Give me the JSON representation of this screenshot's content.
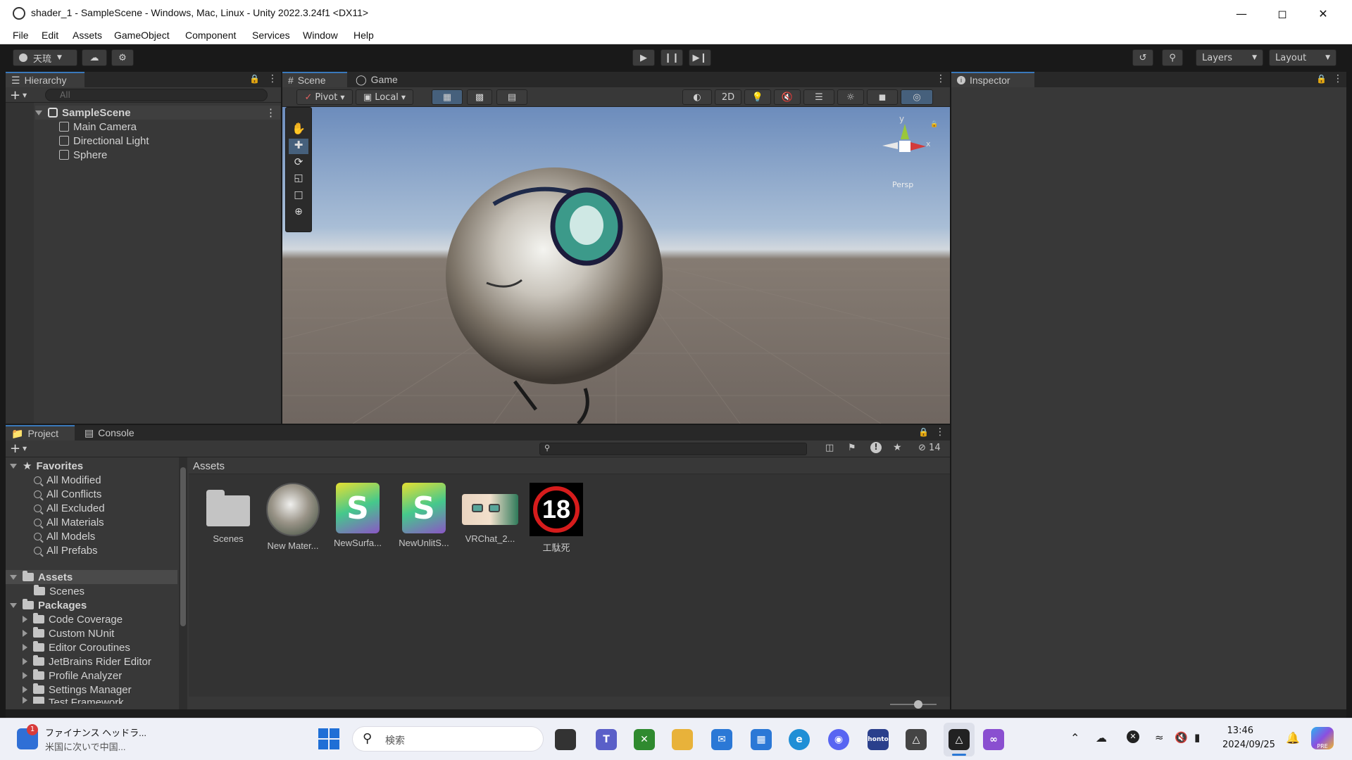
{
  "window": {
    "title": "shader_1 - SampleScene - Windows, Mac, Linux - Unity 2022.3.24f1 <DX11>"
  },
  "menu": [
    "File",
    "Edit",
    "Assets",
    "GameObject",
    "Component",
    "Services",
    "Window",
    "Help"
  ],
  "toolbar": {
    "account": "天琉",
    "layers": "Layers",
    "layout": "Layout"
  },
  "hierarchy": {
    "tab": "Hierarchy",
    "search_placeholder": "All",
    "scene": "SampleScene",
    "objects": [
      "Main Camera",
      "Directional Light",
      "Sphere"
    ]
  },
  "scene_view": {
    "tabs": [
      "Scene",
      "Game"
    ],
    "pivot": "Pivot",
    "space": "Local",
    "mode_2d": "2D",
    "gizmo": {
      "y": "y",
      "x": "x",
      "persp": "Persp"
    }
  },
  "inspector": {
    "tab": "Inspector"
  },
  "project": {
    "tabs": [
      "Project",
      "Console"
    ],
    "hidden_count": "14",
    "favorites_label": "Favorites",
    "favorites": [
      "All Modified",
      "All Conflicts",
      "All Excluded",
      "All Materials",
      "All Models",
      "All Prefabs"
    ],
    "assets_label": "Assets",
    "assets_children": [
      "Scenes"
    ],
    "packages_label": "Packages",
    "packages": [
      "Code Coverage",
      "Custom NUnit",
      "Editor Coroutines",
      "JetBrains Rider Editor",
      "Profile Analyzer",
      "Settings Manager",
      "Test Framework"
    ],
    "breadcrumb": "Assets",
    "items": [
      {
        "label": "Scenes",
        "kind": "folder"
      },
      {
        "label": "New Mater...",
        "kind": "material"
      },
      {
        "label": "NewSurfa...",
        "kind": "shader"
      },
      {
        "label": "NewUnlitS...",
        "kind": "shader"
      },
      {
        "label": "VRChat_2...",
        "kind": "texture"
      },
      {
        "label": "工駄死",
        "kind": "texture18"
      }
    ],
    "badge_18": "18"
  },
  "taskbar": {
    "news_title": "ファイナンス ヘッドラ...",
    "news_sub": "米国に次いで中国...",
    "news_badge": "1",
    "search": "検索",
    "time": "13:46",
    "date": "2024/09/25",
    "honto": "honto",
    "copilot": "PRE"
  },
  "colors": {
    "accent": "#3a79bb",
    "panel": "#383838",
    "dark": "#282828",
    "scene_sky": "#9bb2cf",
    "scene_ground": "#6f6660"
  }
}
